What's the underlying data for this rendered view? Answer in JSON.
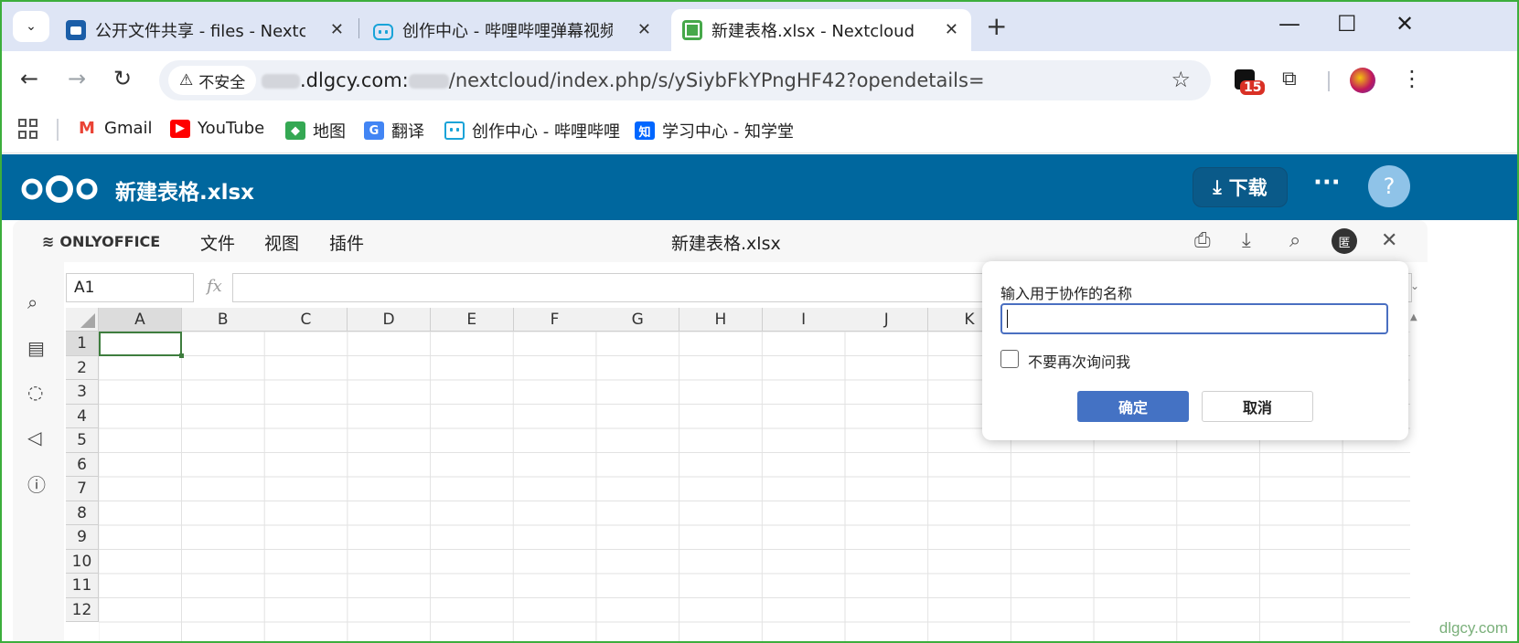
{
  "browser": {
    "tabs": [
      {
        "label": "公开文件共享 - files - Nextcloud",
        "favicon": "nextcloud-icon",
        "active": false
      },
      {
        "label": "创作中心 - 哔哩哔哩弹幕视频网",
        "favicon": "bilibili-icon",
        "active": false
      },
      {
        "label": "新建表格.xlsx - Nextcloud",
        "favicon": "spreadsheet-icon",
        "active": true
      }
    ],
    "security_label": "不安全",
    "url_host": ".dlgcy.com:",
    "url_path": "/nextcloud/index.php/s/ySiybFkYPngHF42?opendetails=",
    "extension_badge": "15",
    "bookmarks": [
      {
        "label": "Gmail",
        "icon": "gmail-icon",
        "color": "#ea4335"
      },
      {
        "label": "YouTube",
        "icon": "youtube-icon",
        "color": "#ff0000"
      },
      {
        "label": "地图",
        "icon": "maps-icon",
        "color": "#34a853"
      },
      {
        "label": "翻译",
        "icon": "translate-icon",
        "color": "#4285f4"
      },
      {
        "label": "创作中心 - 哔哩哔哩",
        "icon": "bilibili-icon",
        "color": "#19a3d8"
      },
      {
        "label": "学习中心 - 知学堂",
        "icon": "zhihu-icon",
        "color": "#0066ff"
      }
    ]
  },
  "nextcloud": {
    "file_title": "新建表格.xlsx",
    "download_label": "下载",
    "help_label": "?",
    "brand_color": "#00679e"
  },
  "editor": {
    "brand": "ONLYOFFICE",
    "menus": [
      "文件",
      "视图",
      "插件"
    ],
    "doc_name": "新建表格.xlsx",
    "user_initial": "匿",
    "cell_ref": "A1",
    "fx_label": "fx",
    "columns": [
      "A",
      "B",
      "C",
      "D",
      "E",
      "F",
      "G",
      "H",
      "I",
      "J",
      "K"
    ],
    "rows": [
      "1",
      "2",
      "3",
      "4",
      "5",
      "6",
      "7",
      "8",
      "9",
      "10",
      "11",
      "12"
    ],
    "selected_cell": "A1"
  },
  "dialog": {
    "label": "输入用于协作的名称",
    "input_value": "",
    "checkbox_label": "不要再次询问我",
    "checkbox_checked": false,
    "ok_label": "确定",
    "cancel_label": "取消"
  },
  "watermark": "dlgcy.com"
}
